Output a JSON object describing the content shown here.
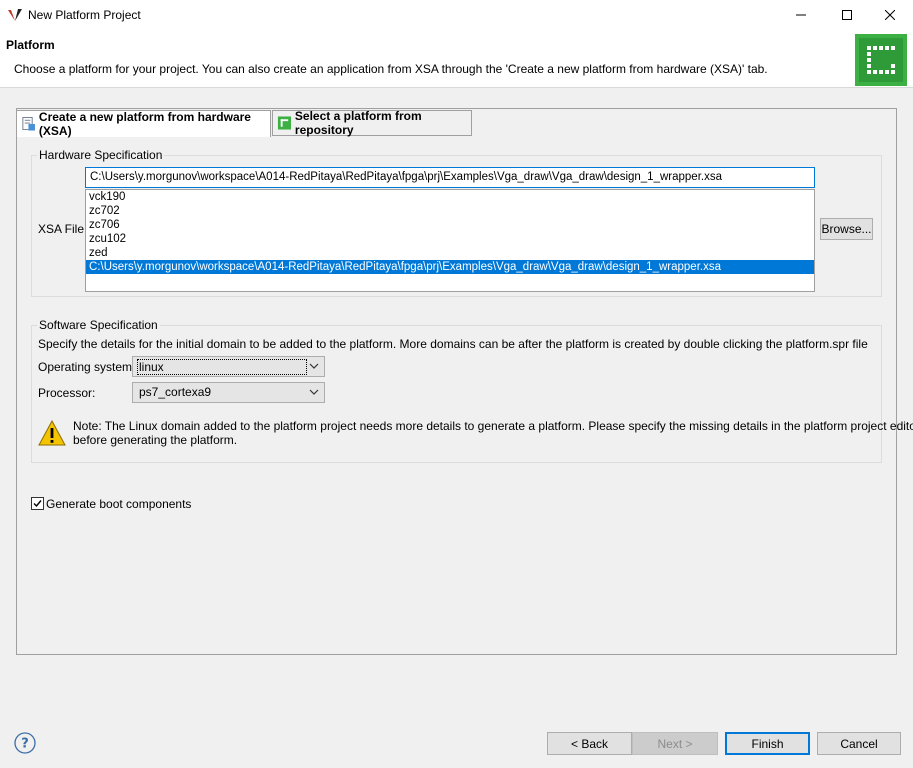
{
  "window": {
    "title": "New Platform Project"
  },
  "header": {
    "title": "Platform",
    "description": "Choose a platform for your project. You can also create an application from XSA through the 'Create a new platform from hardware (XSA)' tab."
  },
  "tabs": [
    {
      "label": "Create a new platform from hardware (XSA)",
      "active": true
    },
    {
      "label": "Select a platform from repository",
      "active": false
    }
  ],
  "hardware": {
    "group_label": "Hardware Specification",
    "xsa_label": "XSA File:",
    "xsa_value": "C:\\Users\\y.morgunov\\workspace\\A014-RedPitaya\\RedPitaya\\fpga\\prj\\Examples\\Vga_draw\\Vga_draw\\design_1_wrapper.xsa",
    "options": [
      "vck190",
      "zc702",
      "zc706",
      "zcu102",
      "zed",
      "C:\\Users\\y.morgunov\\workspace\\A014-RedPitaya\\RedPitaya\\fpga\\prj\\Examples\\Vga_draw\\Vga_draw\\design_1_wrapper.xsa"
    ],
    "browse_label": "Browse..."
  },
  "software": {
    "group_label": "Software Specification",
    "description": "Specify the details for the initial domain to be added to the platform. More domains can be after the platform is created by double clicking the platform.spr file",
    "os_label": "Operating system:",
    "os_value": "linux",
    "processor_label": "Processor:",
    "processor_value": "ps7_cortexa9",
    "note_line1": "Note: The Linux domain added to the platform project needs more details to generate a platform. Please specify the missing details in the platform project editor",
    "note_line2": "before generating the platform."
  },
  "boot": {
    "label": "Generate boot components",
    "checked": true
  },
  "footer": {
    "back_label": "< Back",
    "next_label": "Next >",
    "finish_label": "Finish",
    "cancel_label": "Cancel"
  },
  "colors": {
    "accent": "#0078d7",
    "logo_green": "#3cb043",
    "warning_yellow": "#f5c400"
  }
}
